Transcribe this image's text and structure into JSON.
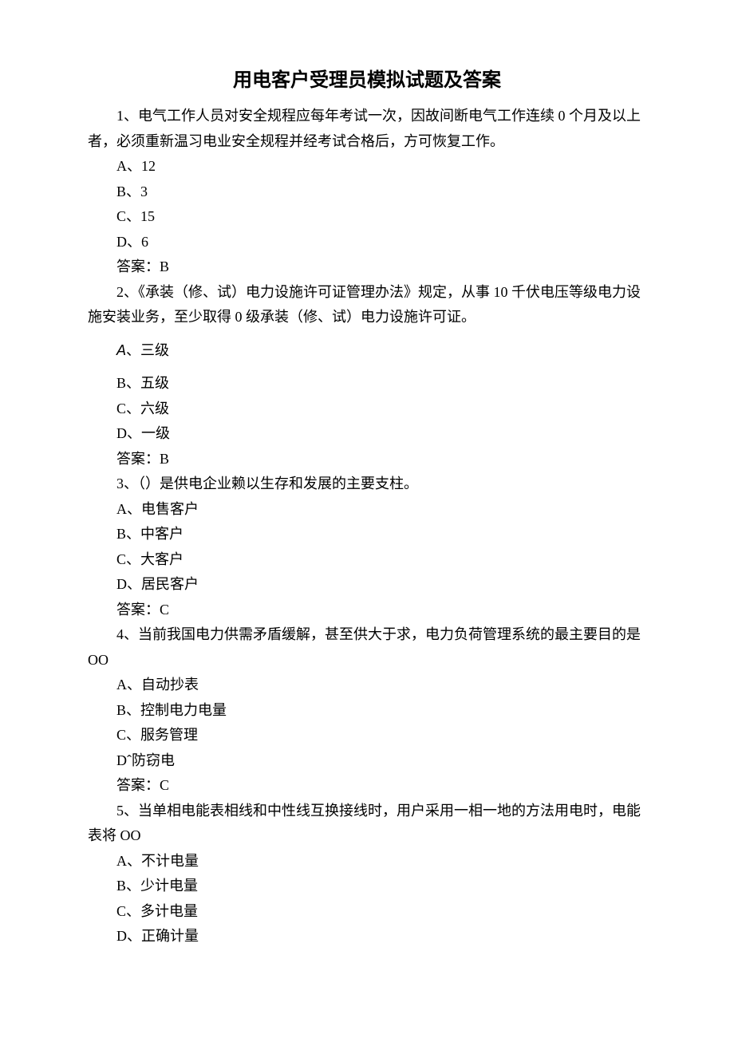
{
  "title": "用电客户受理员模拟试题及答案",
  "questions": [
    {
      "stem": "1、电气工作人员对安全规程应每年考试一次，因故间断电气工作连续 0 个月及以上者，必须重新温习电业安全规程并经考试合格后，方可恢复工作。",
      "options": {
        "A": "A、12",
        "B": "B、3",
        "C": "C、15",
        "D": "D、6"
      },
      "answer": "答案：B"
    },
    {
      "stem": "2、《承装（修、试）电力设施许可证管理办法》规定，从事 10 千伏电压等级电力设施安装业务，至少取得 0 级承装（修、试）电力设施许可证。",
      "options": {
        "A_prefix": "A",
        "A_text": "、三级",
        "B": "B、五级",
        "C": "C、六级",
        "D": "D、一级"
      },
      "answer": "答案：B"
    },
    {
      "stem": "3、（）是供电企业赖以生存和发展的主要支柱。",
      "options": {
        "A": "A、电售客户",
        "B": "B、中客户",
        "C": "C、大客户",
        "D": "D、居民客户"
      },
      "answer": "答案：C"
    },
    {
      "stem": "4、当前我国电力供需矛盾缓解，甚至供大于求，电力负荷管理系统的最主要目的是 OO",
      "options": {
        "A": "A、自动抄表",
        "B": "B、控制电力电量",
        "C": "C、服务管理",
        "D": "Dˆ防窃电"
      },
      "answer": "答案：C"
    },
    {
      "stem": "5、当单相电能表相线和中性线互换接线时，用户采用一相一地的方法用电时，电能表将 OO",
      "options": {
        "A": "A、不计电量",
        "B": "B、少计电量",
        "C": "C、多计电量",
        "D": "D、正确计量"
      },
      "answer": ""
    }
  ]
}
